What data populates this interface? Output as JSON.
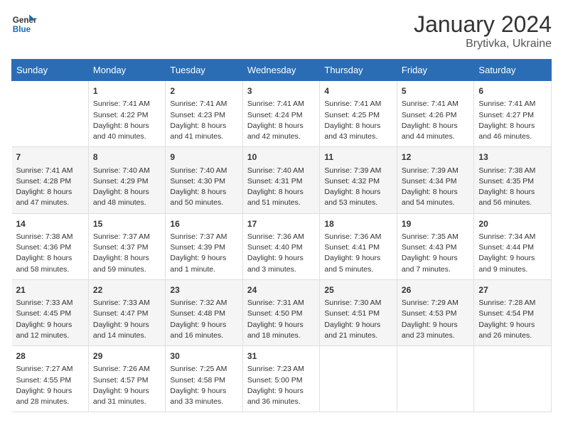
{
  "header": {
    "logo_line1": "General",
    "logo_line2": "Blue",
    "month_year": "January 2024",
    "location": "Brytivka, Ukraine"
  },
  "days_of_week": [
    "Sunday",
    "Monday",
    "Tuesday",
    "Wednesday",
    "Thursday",
    "Friday",
    "Saturday"
  ],
  "weeks": [
    [
      {
        "day": "",
        "info": ""
      },
      {
        "day": "1",
        "info": "Sunrise: 7:41 AM\nSunset: 4:22 PM\nDaylight: 8 hours\nand 40 minutes."
      },
      {
        "day": "2",
        "info": "Sunrise: 7:41 AM\nSunset: 4:23 PM\nDaylight: 8 hours\nand 41 minutes."
      },
      {
        "day": "3",
        "info": "Sunrise: 7:41 AM\nSunset: 4:24 PM\nDaylight: 8 hours\nand 42 minutes."
      },
      {
        "day": "4",
        "info": "Sunrise: 7:41 AM\nSunset: 4:25 PM\nDaylight: 8 hours\nand 43 minutes."
      },
      {
        "day": "5",
        "info": "Sunrise: 7:41 AM\nSunset: 4:26 PM\nDaylight: 8 hours\nand 44 minutes."
      },
      {
        "day": "6",
        "info": "Sunrise: 7:41 AM\nSunset: 4:27 PM\nDaylight: 8 hours\nand 46 minutes."
      }
    ],
    [
      {
        "day": "7",
        "info": "Sunrise: 7:41 AM\nSunset: 4:28 PM\nDaylight: 8 hours\nand 47 minutes."
      },
      {
        "day": "8",
        "info": "Sunrise: 7:40 AM\nSunset: 4:29 PM\nDaylight: 8 hours\nand 48 minutes."
      },
      {
        "day": "9",
        "info": "Sunrise: 7:40 AM\nSunset: 4:30 PM\nDaylight: 8 hours\nand 50 minutes."
      },
      {
        "day": "10",
        "info": "Sunrise: 7:40 AM\nSunset: 4:31 PM\nDaylight: 8 hours\nand 51 minutes."
      },
      {
        "day": "11",
        "info": "Sunrise: 7:39 AM\nSunset: 4:32 PM\nDaylight: 8 hours\nand 53 minutes."
      },
      {
        "day": "12",
        "info": "Sunrise: 7:39 AM\nSunset: 4:34 PM\nDaylight: 8 hours\nand 54 minutes."
      },
      {
        "day": "13",
        "info": "Sunrise: 7:38 AM\nSunset: 4:35 PM\nDaylight: 8 hours\nand 56 minutes."
      }
    ],
    [
      {
        "day": "14",
        "info": "Sunrise: 7:38 AM\nSunset: 4:36 PM\nDaylight: 8 hours\nand 58 minutes."
      },
      {
        "day": "15",
        "info": "Sunrise: 7:37 AM\nSunset: 4:37 PM\nDaylight: 8 hours\nand 59 minutes."
      },
      {
        "day": "16",
        "info": "Sunrise: 7:37 AM\nSunset: 4:39 PM\nDaylight: 9 hours\nand 1 minute."
      },
      {
        "day": "17",
        "info": "Sunrise: 7:36 AM\nSunset: 4:40 PM\nDaylight: 9 hours\nand 3 minutes."
      },
      {
        "day": "18",
        "info": "Sunrise: 7:36 AM\nSunset: 4:41 PM\nDaylight: 9 hours\nand 5 minutes."
      },
      {
        "day": "19",
        "info": "Sunrise: 7:35 AM\nSunset: 4:43 PM\nDaylight: 9 hours\nand 7 minutes."
      },
      {
        "day": "20",
        "info": "Sunrise: 7:34 AM\nSunset: 4:44 PM\nDaylight: 9 hours\nand 9 minutes."
      }
    ],
    [
      {
        "day": "21",
        "info": "Sunrise: 7:33 AM\nSunset: 4:45 PM\nDaylight: 9 hours\nand 12 minutes."
      },
      {
        "day": "22",
        "info": "Sunrise: 7:33 AM\nSunset: 4:47 PM\nDaylight: 9 hours\nand 14 minutes."
      },
      {
        "day": "23",
        "info": "Sunrise: 7:32 AM\nSunset: 4:48 PM\nDaylight: 9 hours\nand 16 minutes."
      },
      {
        "day": "24",
        "info": "Sunrise: 7:31 AM\nSunset: 4:50 PM\nDaylight: 9 hours\nand 18 minutes."
      },
      {
        "day": "25",
        "info": "Sunrise: 7:30 AM\nSunset: 4:51 PM\nDaylight: 9 hours\nand 21 minutes."
      },
      {
        "day": "26",
        "info": "Sunrise: 7:29 AM\nSunset: 4:53 PM\nDaylight: 9 hours\nand 23 minutes."
      },
      {
        "day": "27",
        "info": "Sunrise: 7:28 AM\nSunset: 4:54 PM\nDaylight: 9 hours\nand 26 minutes."
      }
    ],
    [
      {
        "day": "28",
        "info": "Sunrise: 7:27 AM\nSunset: 4:55 PM\nDaylight: 9 hours\nand 28 minutes."
      },
      {
        "day": "29",
        "info": "Sunrise: 7:26 AM\nSunset: 4:57 PM\nDaylight: 9 hours\nand 31 minutes."
      },
      {
        "day": "30",
        "info": "Sunrise: 7:25 AM\nSunset: 4:58 PM\nDaylight: 9 hours\nand 33 minutes."
      },
      {
        "day": "31",
        "info": "Sunrise: 7:23 AM\nSunset: 5:00 PM\nDaylight: 9 hours\nand 36 minutes."
      },
      {
        "day": "",
        "info": ""
      },
      {
        "day": "",
        "info": ""
      },
      {
        "day": "",
        "info": ""
      }
    ]
  ]
}
